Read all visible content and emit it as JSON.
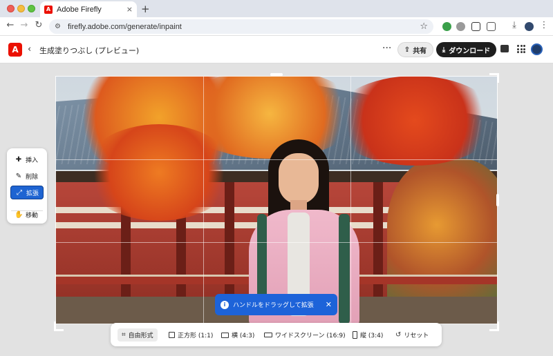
{
  "browser": {
    "tab_title": "Adobe Firefly",
    "tab_close": "×",
    "new_tab": "+",
    "url": "firefly.adobe.com/generate/inpaint"
  },
  "app": {
    "logo": "A",
    "page_title": "生成塗りつぶし (プレビュー)",
    "more": "···",
    "share_label": "共有",
    "download_label": "ダウンロード",
    "accent_color": "#1e64d2",
    "brand_color": "#eb1000"
  },
  "tools": {
    "items": [
      {
        "label": "挿入",
        "icon": "insert-icon"
      },
      {
        "label": "削除",
        "icon": "erase-icon"
      },
      {
        "label": "拡張",
        "icon": "expand-icon",
        "active": true
      },
      {
        "label": "移動",
        "icon": "move-icon"
      }
    ]
  },
  "toast": {
    "message": "ハンドルをドラッグして拡張",
    "close": "✕"
  },
  "aspect": {
    "options": [
      {
        "label": "自由形式",
        "icon": "crop-icon",
        "active": true
      },
      {
        "label": "正方形 (1:1)",
        "icon": "square-icon"
      },
      {
        "label": "横 (4:3)",
        "icon": "landscape-icon"
      },
      {
        "label": "ワイドスクリーン (16:9)",
        "icon": "widescreen-icon"
      },
      {
        "label": "縦 (3:4)",
        "icon": "portrait-icon"
      },
      {
        "label": "リセット",
        "icon": "reset-icon"
      }
    ]
  }
}
